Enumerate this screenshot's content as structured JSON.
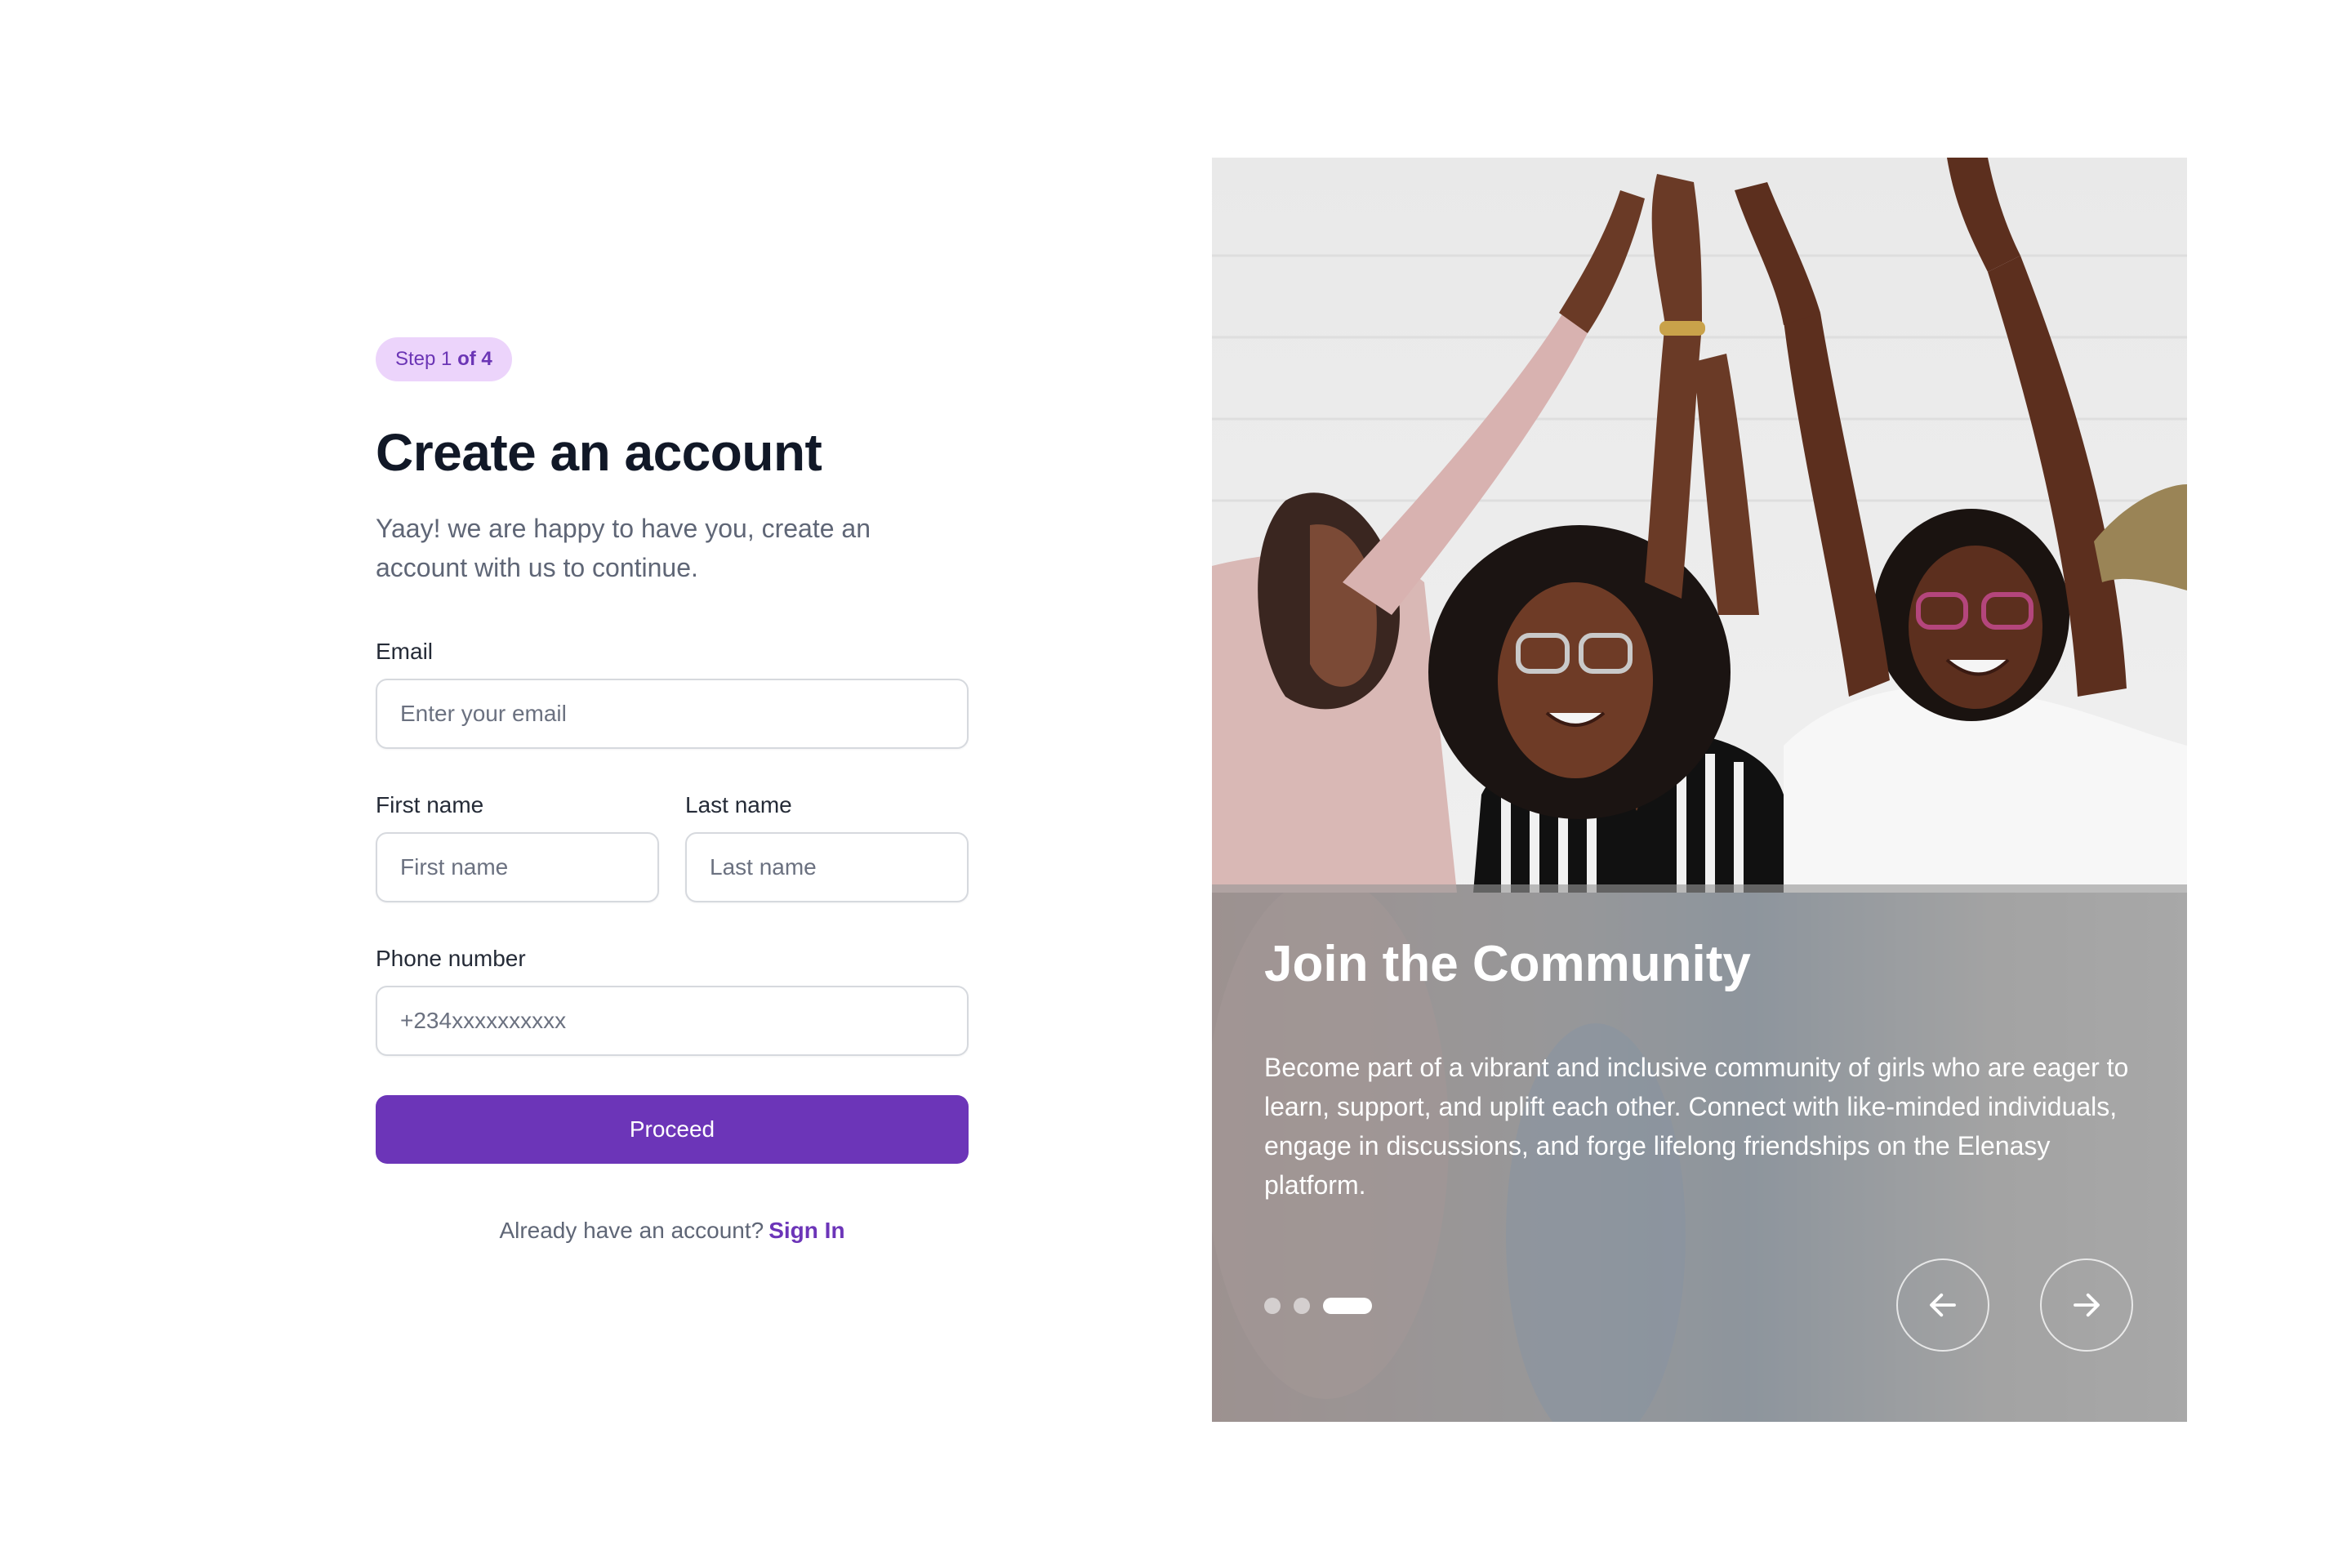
{
  "step": {
    "prefix": "Step 1",
    "suffix": "of 4"
  },
  "form": {
    "title": "Create an account",
    "subtitle": "Yaay! we are happy to have you, create an account with us to continue.",
    "email": {
      "label": "Email",
      "placeholder": "Enter your email"
    },
    "first_name": {
      "label": "First name",
      "placeholder": "First name"
    },
    "last_name": {
      "label": "Last name",
      "placeholder": "Last name"
    },
    "phone": {
      "label": "Phone number",
      "placeholder": "+234xxxxxxxxxx"
    },
    "proceed_label": "Proceed",
    "signin_prompt": "Already have an account?",
    "signin_link": "Sign In"
  },
  "hero": {
    "title": "Join the Community",
    "text": "Become part of a vibrant and inclusive community of girls who are eager to learn, support, and uplift each other. Connect with like-minded individuals, engage in discussions, and forge lifelong friendships on the Elenasy platform.",
    "slides_total": 3,
    "active_slide": 3,
    "prev_icon": "arrow-left-icon",
    "next_icon": "arrow-right-icon"
  },
  "colors": {
    "accent": "#6c35b8",
    "badge_bg": "#ecd4fb",
    "title": "#111827",
    "muted": "#5f6676"
  }
}
